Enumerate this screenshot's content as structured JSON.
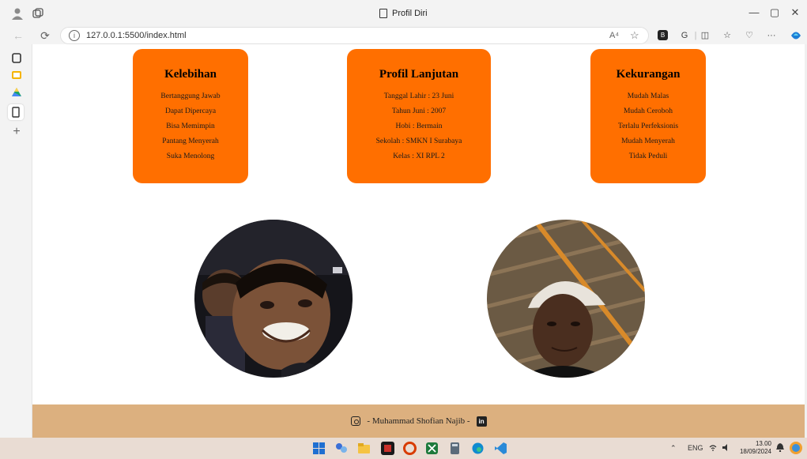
{
  "window": {
    "tab_title": "Profil Diri",
    "controls": {
      "minimize": "—",
      "maximize": "▢",
      "close": "✕"
    }
  },
  "address_bar": {
    "url": "127.0.0.1:5500/index.html",
    "read_aloud": "A⁴"
  },
  "cards": {
    "kelebihan": {
      "title": "Kelebihan",
      "items": [
        "Bertanggung Jawab",
        "Dapat Dipercaya",
        "Bisa Memimpin",
        "Pantang Menyerah",
        "Suka Menolong"
      ]
    },
    "profil": {
      "title": "Profil Lanjutan",
      "items": [
        "Tanggal Lahir : 23 Juni",
        "Tahun Juni : 2007",
        "Hobi : Bermain",
        "Sekolah : SMKN I Surabaya",
        "Kelas : XI RPL 2"
      ]
    },
    "kekurangan": {
      "title": "Kekurangan",
      "items": [
        "Mudah Malas",
        "Mudah Ceroboh",
        "Terlalu Perfeksionis",
        "Mudah Menyerah",
        "Tidak Peduli"
      ]
    }
  },
  "footer": {
    "text": "- Muhammad Shofian Najib -",
    "linkedin_glyph": "in"
  },
  "taskbar": {
    "language": "ENG",
    "time": "13.00",
    "date": "18/09/2024"
  },
  "colors": {
    "card_bg": "#ff6f00",
    "footer_bg": "#dcb07f",
    "taskbar_bg": "#e9dcd3"
  }
}
